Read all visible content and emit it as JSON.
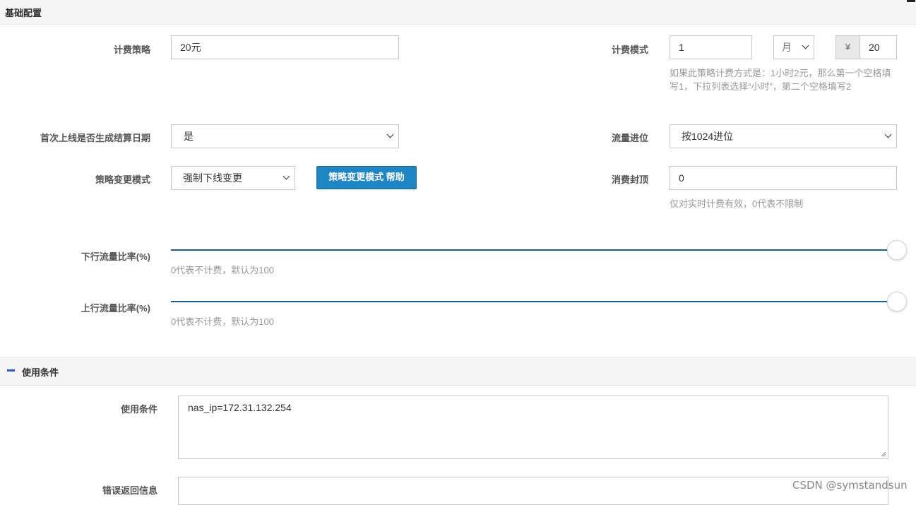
{
  "sections": {
    "basic": "基础配置",
    "conditions": "使用条件"
  },
  "billing_strategy": {
    "label": "计费策略",
    "value": "20元"
  },
  "billing_mode": {
    "label": "计费模式",
    "quantity": "1",
    "unit": "月",
    "currency_symbol": "¥",
    "price": "20",
    "help": "如果此策略计费方式是：1小时2元，那么第一个空格填写1，下拉列表选择“小时”，第二个空格填写2"
  },
  "first_online": {
    "label": "首次上线是否生成结算日期",
    "value": "是"
  },
  "traffic_carry": {
    "label": "流量进位",
    "value": "按1024进位"
  },
  "change_mode": {
    "label": "策略变更模式",
    "value": "强制下线变更",
    "help_button": "策略变更模式 帮助"
  },
  "consumption_cap": {
    "label": "消费封顶",
    "value": "0",
    "help": "仅对实时计费有效，0代表不限制"
  },
  "down_ratio": {
    "label": "下行流量比率(%)",
    "help": "0代表不计费，默认为100",
    "level_percent": 100
  },
  "up_ratio": {
    "label": "上行流量比率(%)",
    "help": "0代表不计费，默认为100",
    "level_percent": 100
  },
  "use_condition": {
    "label": "使用条件",
    "value": "nas_ip=172.31.132.254"
  },
  "error_return": {
    "label": "错误返回信息",
    "value": ""
  },
  "watermark": "CSDN @symstandsun",
  "colors": {
    "button": "#1f86c4",
    "slider": "#1a5e94",
    "collapse_icon": "#2a5bd7"
  }
}
